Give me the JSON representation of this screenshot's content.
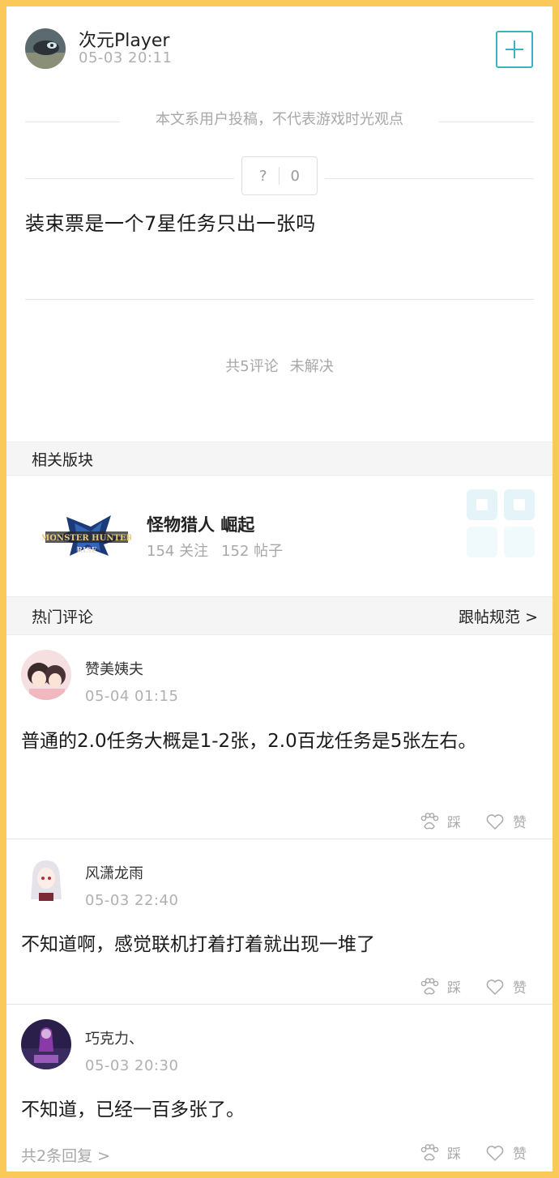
{
  "author": {
    "name": "次元Player",
    "time": "05-03 20:11"
  },
  "notice": "本文系用户投稿，不代表游戏时光观点",
  "vote": {
    "icon_label": "?",
    "count": "0"
  },
  "post": {
    "title": "装束票是一个7星任务只出一张吗"
  },
  "stats": {
    "comments": "共5评论",
    "status": "未解决"
  },
  "related": {
    "header": "相关版块",
    "board": {
      "name": "怪物猎人 崛起",
      "followers": "154 关注",
      "posts": "152 帖子",
      "logo_line1": "MONSTER HUNTER",
      "logo_line2": "RISE"
    }
  },
  "hot": {
    "header": "热门评论",
    "rules_link": "跟帖规范 >"
  },
  "comments": [
    {
      "name": "赞美姨夫",
      "time": "05-04 01:15",
      "text": "普通的2.0任务大概是1-2张，2.0百龙任务是5张左右。",
      "dislike": "踩",
      "like": "赞"
    },
    {
      "name": "风潇龙雨",
      "time": "05-03 22:40",
      "text": "不知道啊，感觉联机打着打着就出现一堆了",
      "dislike": "踩",
      "like": "赞"
    },
    {
      "name": "巧克力、",
      "time": "05-03 20:30",
      "text": "不知道，已经一百多张了。",
      "replies": "共2条回复 >",
      "dislike": "踩",
      "like": "赞"
    }
  ],
  "colors": {
    "accent": "#3bb3c3",
    "frame": "#fbc95a",
    "muted": "#a8a8a8"
  }
}
